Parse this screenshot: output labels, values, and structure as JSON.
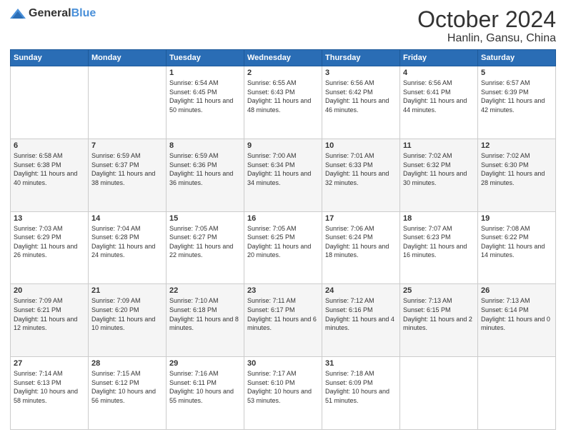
{
  "logo": {
    "general": "General",
    "blue": "Blue"
  },
  "header": {
    "month": "October 2024",
    "location": "Hanlin, Gansu, China"
  },
  "weekdays": [
    "Sunday",
    "Monday",
    "Tuesday",
    "Wednesday",
    "Thursday",
    "Friday",
    "Saturday"
  ],
  "weeks": [
    [
      {
        "day": "",
        "info": ""
      },
      {
        "day": "",
        "info": ""
      },
      {
        "day": "1",
        "info": "Sunrise: 6:54 AM\nSunset: 6:45 PM\nDaylight: 11 hours and 50 minutes."
      },
      {
        "day": "2",
        "info": "Sunrise: 6:55 AM\nSunset: 6:43 PM\nDaylight: 11 hours and 48 minutes."
      },
      {
        "day": "3",
        "info": "Sunrise: 6:56 AM\nSunset: 6:42 PM\nDaylight: 11 hours and 46 minutes."
      },
      {
        "day": "4",
        "info": "Sunrise: 6:56 AM\nSunset: 6:41 PM\nDaylight: 11 hours and 44 minutes."
      },
      {
        "day": "5",
        "info": "Sunrise: 6:57 AM\nSunset: 6:39 PM\nDaylight: 11 hours and 42 minutes."
      }
    ],
    [
      {
        "day": "6",
        "info": "Sunrise: 6:58 AM\nSunset: 6:38 PM\nDaylight: 11 hours and 40 minutes."
      },
      {
        "day": "7",
        "info": "Sunrise: 6:59 AM\nSunset: 6:37 PM\nDaylight: 11 hours and 38 minutes."
      },
      {
        "day": "8",
        "info": "Sunrise: 6:59 AM\nSunset: 6:36 PM\nDaylight: 11 hours and 36 minutes."
      },
      {
        "day": "9",
        "info": "Sunrise: 7:00 AM\nSunset: 6:34 PM\nDaylight: 11 hours and 34 minutes."
      },
      {
        "day": "10",
        "info": "Sunrise: 7:01 AM\nSunset: 6:33 PM\nDaylight: 11 hours and 32 minutes."
      },
      {
        "day": "11",
        "info": "Sunrise: 7:02 AM\nSunset: 6:32 PM\nDaylight: 11 hours and 30 minutes."
      },
      {
        "day": "12",
        "info": "Sunrise: 7:02 AM\nSunset: 6:30 PM\nDaylight: 11 hours and 28 minutes."
      }
    ],
    [
      {
        "day": "13",
        "info": "Sunrise: 7:03 AM\nSunset: 6:29 PM\nDaylight: 11 hours and 26 minutes."
      },
      {
        "day": "14",
        "info": "Sunrise: 7:04 AM\nSunset: 6:28 PM\nDaylight: 11 hours and 24 minutes."
      },
      {
        "day": "15",
        "info": "Sunrise: 7:05 AM\nSunset: 6:27 PM\nDaylight: 11 hours and 22 minutes."
      },
      {
        "day": "16",
        "info": "Sunrise: 7:05 AM\nSunset: 6:25 PM\nDaylight: 11 hours and 20 minutes."
      },
      {
        "day": "17",
        "info": "Sunrise: 7:06 AM\nSunset: 6:24 PM\nDaylight: 11 hours and 18 minutes."
      },
      {
        "day": "18",
        "info": "Sunrise: 7:07 AM\nSunset: 6:23 PM\nDaylight: 11 hours and 16 minutes."
      },
      {
        "day": "19",
        "info": "Sunrise: 7:08 AM\nSunset: 6:22 PM\nDaylight: 11 hours and 14 minutes."
      }
    ],
    [
      {
        "day": "20",
        "info": "Sunrise: 7:09 AM\nSunset: 6:21 PM\nDaylight: 11 hours and 12 minutes."
      },
      {
        "day": "21",
        "info": "Sunrise: 7:09 AM\nSunset: 6:20 PM\nDaylight: 11 hours and 10 minutes."
      },
      {
        "day": "22",
        "info": "Sunrise: 7:10 AM\nSunset: 6:18 PM\nDaylight: 11 hours and 8 minutes."
      },
      {
        "day": "23",
        "info": "Sunrise: 7:11 AM\nSunset: 6:17 PM\nDaylight: 11 hours and 6 minutes."
      },
      {
        "day": "24",
        "info": "Sunrise: 7:12 AM\nSunset: 6:16 PM\nDaylight: 11 hours and 4 minutes."
      },
      {
        "day": "25",
        "info": "Sunrise: 7:13 AM\nSunset: 6:15 PM\nDaylight: 11 hours and 2 minutes."
      },
      {
        "day": "26",
        "info": "Sunrise: 7:13 AM\nSunset: 6:14 PM\nDaylight: 11 hours and 0 minutes."
      }
    ],
    [
      {
        "day": "27",
        "info": "Sunrise: 7:14 AM\nSunset: 6:13 PM\nDaylight: 10 hours and 58 minutes."
      },
      {
        "day": "28",
        "info": "Sunrise: 7:15 AM\nSunset: 6:12 PM\nDaylight: 10 hours and 56 minutes."
      },
      {
        "day": "29",
        "info": "Sunrise: 7:16 AM\nSunset: 6:11 PM\nDaylight: 10 hours and 55 minutes."
      },
      {
        "day": "30",
        "info": "Sunrise: 7:17 AM\nSunset: 6:10 PM\nDaylight: 10 hours and 53 minutes."
      },
      {
        "day": "31",
        "info": "Sunrise: 7:18 AM\nSunset: 6:09 PM\nDaylight: 10 hours and 51 minutes."
      },
      {
        "day": "",
        "info": ""
      },
      {
        "day": "",
        "info": ""
      }
    ]
  ]
}
